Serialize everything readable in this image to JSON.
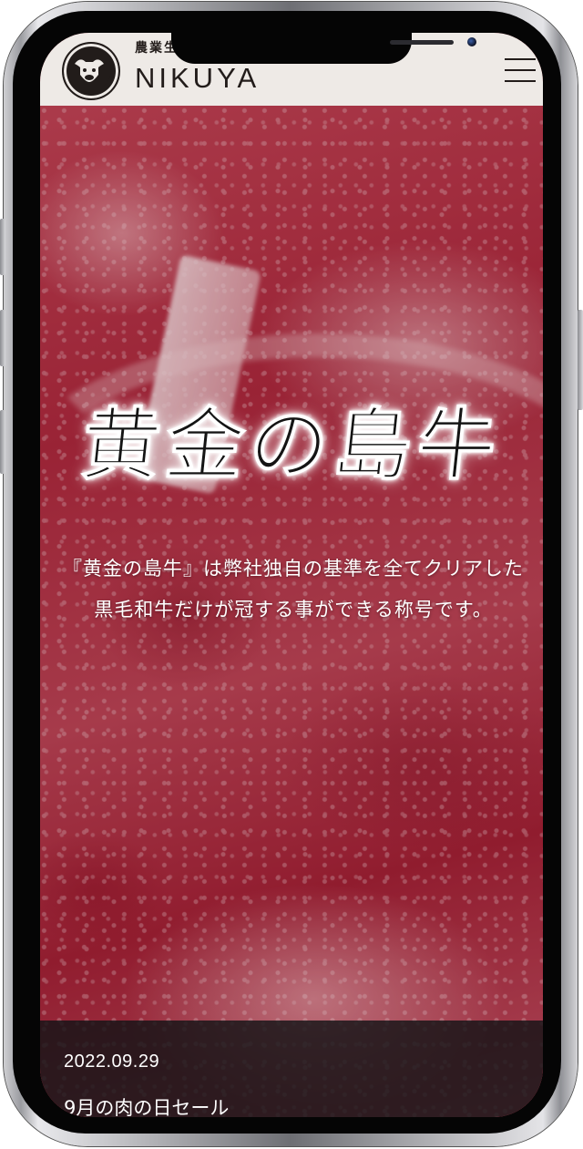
{
  "header": {
    "logo_sub": "農業生産",
    "logo_text": "NIKUYA",
    "logo_mark": "N",
    "menu_icon": "hamburger-icon"
  },
  "hero": {
    "title": "黄金の島牛",
    "description": "『黄金の島牛』は弊社独自の基準を全てクリアした黒毛和牛だけが冠する事ができる称号です。"
  },
  "news": {
    "date": "2022.09.29",
    "title": "9月の肉の日セール"
  },
  "colors": {
    "header_bg": "#eeeae6",
    "logo_ink": "#221c1a",
    "hero_text": "#ffffff",
    "news_bg": "#141416"
  }
}
